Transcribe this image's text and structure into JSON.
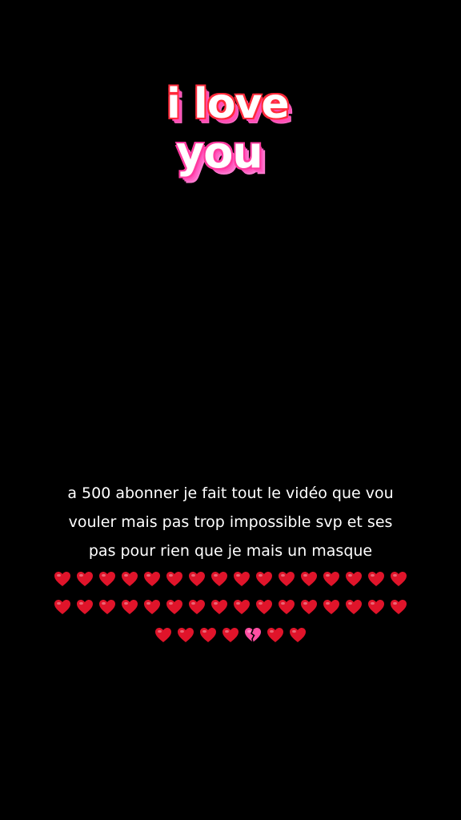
{
  "sticker": {
    "line1": "i love",
    "line2": "you"
  },
  "caption": {
    "lines": [
      "a 500 abonner je fait tout le vidéo que vou",
      "vouler mais pas trop impossible svp et ses",
      "pas pour rien que je mais un masque"
    ],
    "heart_rows": [
      [
        "red-heart",
        "red-heart",
        "red-heart",
        "red-heart",
        "red-heart",
        "red-heart",
        "red-heart",
        "red-heart",
        "red-heart",
        "red-heart",
        "red-heart",
        "red-heart",
        "red-heart",
        "red-heart",
        "red-heart",
        "red-heart"
      ],
      [
        "red-heart",
        "red-heart",
        "red-heart",
        "red-heart",
        "red-heart",
        "red-heart",
        "red-heart",
        "red-heart",
        "red-heart",
        "red-heart",
        "red-heart",
        "red-heart",
        "red-heart",
        "red-heart",
        "red-heart",
        "red-heart"
      ],
      [
        "red-heart",
        "red-heart",
        "red-heart",
        "red-heart",
        "broken-heart",
        "red-heart",
        "red-heart"
      ]
    ]
  },
  "colors": {
    "background": "#000000",
    "text": "#ffffff",
    "red_heart": "#e0142a",
    "broken_heart": "#ff4fa3"
  }
}
